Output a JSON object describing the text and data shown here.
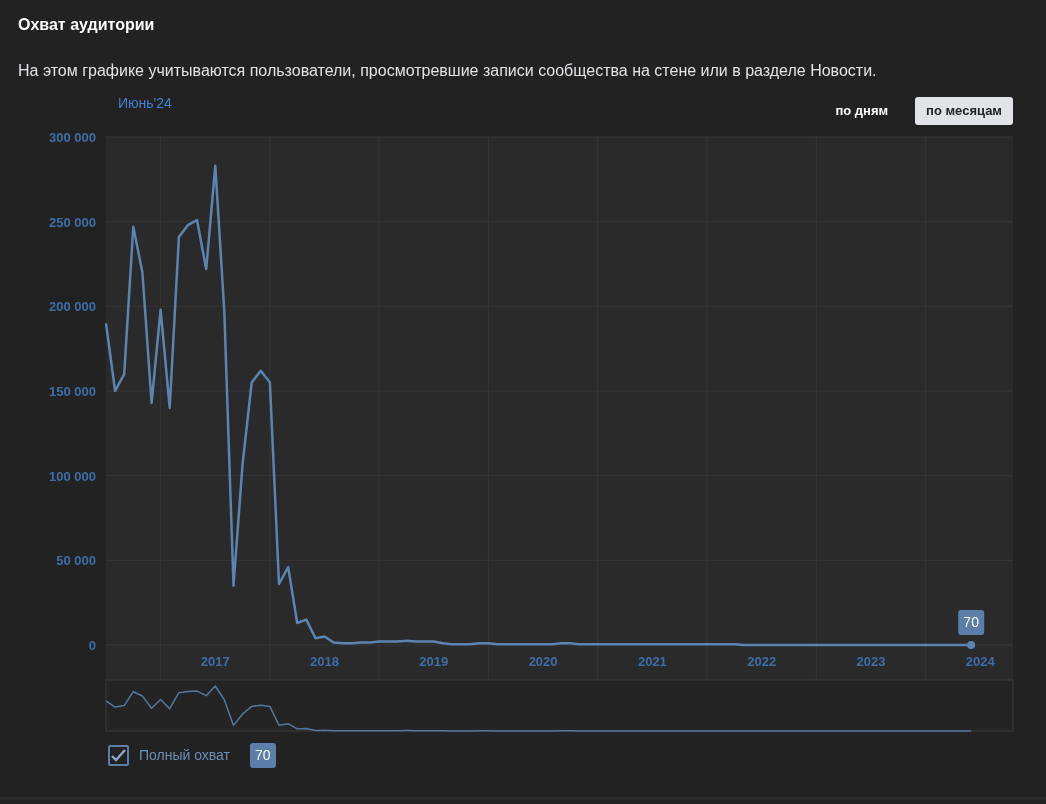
{
  "title": "Охват аудитории",
  "description": "На этом графике учитываются пользователи, просмотревшие записи сообщества на стене или в разделе Новости.",
  "period_label": "Июнь'24",
  "period_buttons": [
    {
      "label": "по дням",
      "selected": false
    },
    {
      "label": "по месяцам",
      "selected": true
    }
  ],
  "chart": {
    "tooltip": "70",
    "chart_data": {
      "type": "line",
      "x": [
        2016.5,
        2016.583,
        2016.667,
        2016.75,
        2016.833,
        2016.917,
        2017,
        2017.083,
        2017.167,
        2017.25,
        2017.333,
        2017.417,
        2017.5,
        2017.583,
        2017.667,
        2017.75,
        2017.833,
        2017.917,
        2018,
        2018.083,
        2018.167,
        2018.25,
        2018.333,
        2018.417,
        2018.5,
        2018.583,
        2018.667,
        2018.75,
        2018.833,
        2018.917,
        2019,
        2019.083,
        2019.167,
        2019.25,
        2019.333,
        2019.417,
        2019.5,
        2019.583,
        2019.667,
        2019.75,
        2019.833,
        2019.917,
        2020,
        2020.083,
        2020.167,
        2020.25,
        2020.333,
        2020.417,
        2020.5,
        2020.583,
        2020.667,
        2020.75,
        2020.833,
        2020.917,
        2021,
        2021.083,
        2021.167,
        2021.25,
        2021.333,
        2021.417,
        2021.5,
        2021.583,
        2021.667,
        2021.75,
        2021.833,
        2021.917,
        2022,
        2022.083,
        2022.167,
        2022.25,
        2022.333,
        2022.417,
        2022.5,
        2022.583,
        2022.667,
        2022.75,
        2022.833,
        2022.917,
        2023,
        2023.083,
        2023.167,
        2023.25,
        2023.333,
        2023.417,
        2023.5,
        2023.583,
        2023.667,
        2023.75,
        2023.833,
        2023.917,
        2024,
        2024.083,
        2024.167,
        2024.25,
        2024.333,
        2024.417
      ],
      "series": [
        {
          "name": "Полный охват",
          "color": "#5b84b1",
          "values": [
            190000,
            150000,
            160000,
            247000,
            220000,
            143000,
            198000,
            140000,
            241000,
            248000,
            251000,
            222000,
            283000,
            197000,
            35000,
            107000,
            155000,
            162000,
            155000,
            36000,
            46000,
            13000,
            15000,
            4000,
            5000,
            1500,
            1000,
            1000,
            1500,
            1500,
            2000,
            2000,
            2000,
            2500,
            2000,
            2000,
            2000,
            1000,
            500,
            500,
            500,
            1000,
            1000,
            500,
            500,
            500,
            500,
            500,
            500,
            500,
            1000,
            1000,
            500,
            500,
            500,
            500,
            500,
            500,
            500,
            500,
            500,
            500,
            500,
            500,
            500,
            500,
            500,
            500,
            500,
            500,
            0,
            0,
            0,
            0,
            0,
            0,
            0,
            0,
            0,
            0,
            0,
            0,
            0,
            0,
            0,
            0,
            0,
            0,
            0,
            0,
            0,
            0,
            0,
            0,
            0,
            70
          ]
        }
      ],
      "grid": true,
      "xlim": [
        2016.5,
        2024.8
      ],
      "ylim": [
        0,
        300000
      ],
      "xticks": [
        {
          "value": 2017.5,
          "label": "2017"
        },
        {
          "value": 2018.5,
          "label": "2018"
        },
        {
          "value": 2019.5,
          "label": "2019"
        },
        {
          "value": 2020.5,
          "label": "2020"
        },
        {
          "value": 2021.5,
          "label": "2021"
        },
        {
          "value": 2022.5,
          "label": "2022"
        },
        {
          "value": 2023.5,
          "label": "2023"
        },
        {
          "value": 2024.5,
          "label": "2024"
        }
      ],
      "yticks": [
        {
          "value": 0,
          "label": "0"
        },
        {
          "value": 50000,
          "label": "50 000"
        },
        {
          "value": 100000,
          "label": "100 000"
        },
        {
          "value": 150000,
          "label": "150 000"
        },
        {
          "value": 200000,
          "label": "200 000"
        },
        {
          "value": 250000,
          "label": "250 000"
        },
        {
          "value": 300000,
          "label": "300 000"
        }
      ]
    }
  },
  "legend": [
    {
      "checked": true,
      "value": "70"
    }
  ]
}
